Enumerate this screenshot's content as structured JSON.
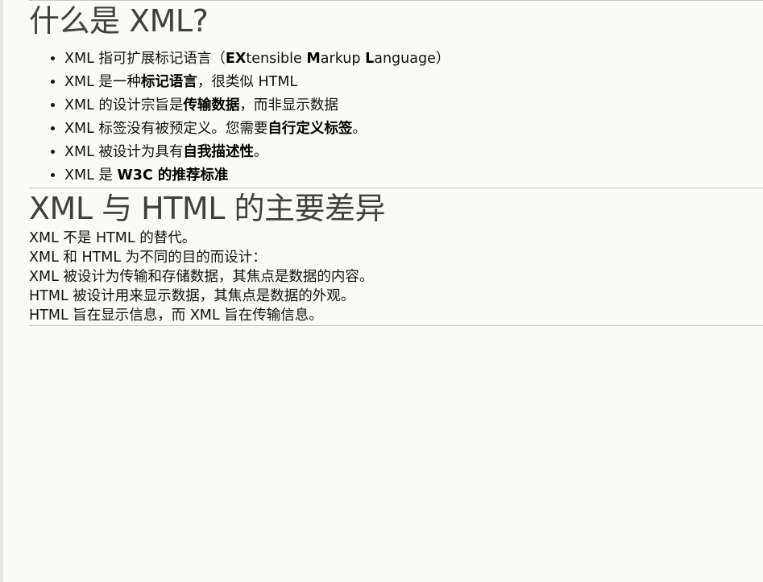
{
  "section1": {
    "title": "什么是 XML?",
    "items": [
      {
        "parts": [
          {
            "t": "XML 指可扩展标记语言（"
          },
          {
            "t": "EX",
            "b": true
          },
          {
            "t": "tensible "
          },
          {
            "t": "M",
            "b": true
          },
          {
            "t": "arkup "
          },
          {
            "t": "L",
            "b": true
          },
          {
            "t": "anguage）"
          }
        ]
      },
      {
        "parts": [
          {
            "t": "XML 是一种"
          },
          {
            "t": "标记语言",
            "b": true
          },
          {
            "t": "，很类似 HTML"
          }
        ]
      },
      {
        "parts": [
          {
            "t": "XML 的设计宗旨是"
          },
          {
            "t": "传输数据",
            "b": true
          },
          {
            "t": "，而非显示数据"
          }
        ]
      },
      {
        "parts": [
          {
            "t": "XML 标签没有被预定义。您需要"
          },
          {
            "t": "自行定义标签",
            "b": true
          },
          {
            "t": "。"
          }
        ]
      },
      {
        "parts": [
          {
            "t": "XML 被设计为具有"
          },
          {
            "t": "自我描述性",
            "b": true
          },
          {
            "t": "。"
          }
        ]
      },
      {
        "parts": [
          {
            "t": "XML 是 "
          },
          {
            "t": "W3C 的推荐标准",
            "b": true
          }
        ]
      }
    ]
  },
  "section2": {
    "title": "XML 与 HTML 的主要差异",
    "paragraphs": [
      "XML 不是 HTML 的替代。",
      "XML 和 HTML 为不同的目的而设计：",
      "XML 被设计为传输和存储数据，其焦点是数据的内容。",
      "HTML 被设计用来显示数据，其焦点是数据的外观。",
      "HTML 旨在显示信息，而 XML 旨在传输信息。"
    ]
  }
}
